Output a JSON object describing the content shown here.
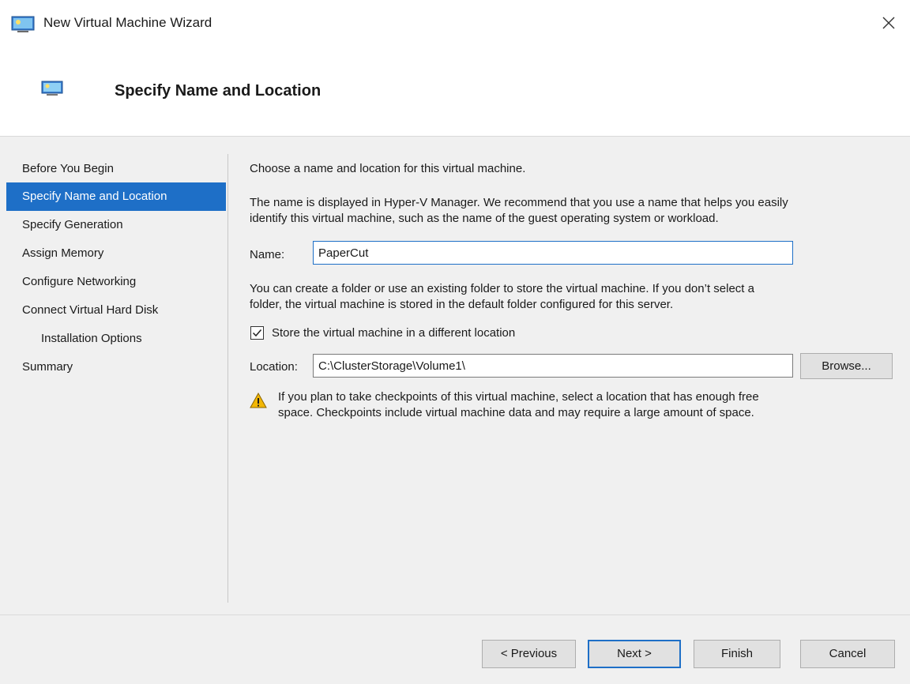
{
  "window": {
    "title": "New Virtual Machine Wizard",
    "close_glyph": "✕"
  },
  "header": {
    "title": "Specify Name and Location"
  },
  "nav": {
    "items": [
      {
        "label": "Before You Begin",
        "active": false
      },
      {
        "label": "Specify Name and Location",
        "active": true
      },
      {
        "label": "Specify Generation",
        "active": false
      },
      {
        "label": "Assign Memory",
        "active": false
      },
      {
        "label": "Configure Networking",
        "active": false
      },
      {
        "label": "Connect Virtual Hard Disk",
        "active": false
      },
      {
        "label": "Installation Options",
        "active": false
      },
      {
        "label": "Summary",
        "active": false
      }
    ]
  },
  "content": {
    "intro": "Choose a name and location for this virtual machine.",
    "name_help_line1": "The name is displayed in Hyper-V Manager. We recommend that you use a name that helps you easily",
    "name_help_line2": "identify this virtual machine, such as the name of the guest operating system or workload.",
    "name_label": "Name:",
    "name_value": "PaperCut",
    "folder_help_line1": "You can create a folder or use an existing folder to store the virtual machine. If you don’t select a",
    "folder_help_line2": "folder, the virtual machine is stored in the default folder configured for this server.",
    "store_checkbox_label": "Store the virtual machine in a different location",
    "store_checkbox_checked": true,
    "location_label": "Location:",
    "location_value": "C:\\ClusterStorage\\Volume1\\",
    "browse_label": "Browse...",
    "warning_line1": "If you plan to take checkpoints of this virtual machine, select a location that has enough free",
    "warning_line2": "space. Checkpoints include virtual machine data and may require a large amount of space."
  },
  "footer": {
    "previous_label": "< Previous",
    "next_label": "Next >",
    "finish_label": "Finish",
    "cancel_label": "Cancel"
  },
  "colors": {
    "accent": "#1e6fc7",
    "warning": "#f2b705",
    "panel_bg": "#f0f0f0"
  }
}
